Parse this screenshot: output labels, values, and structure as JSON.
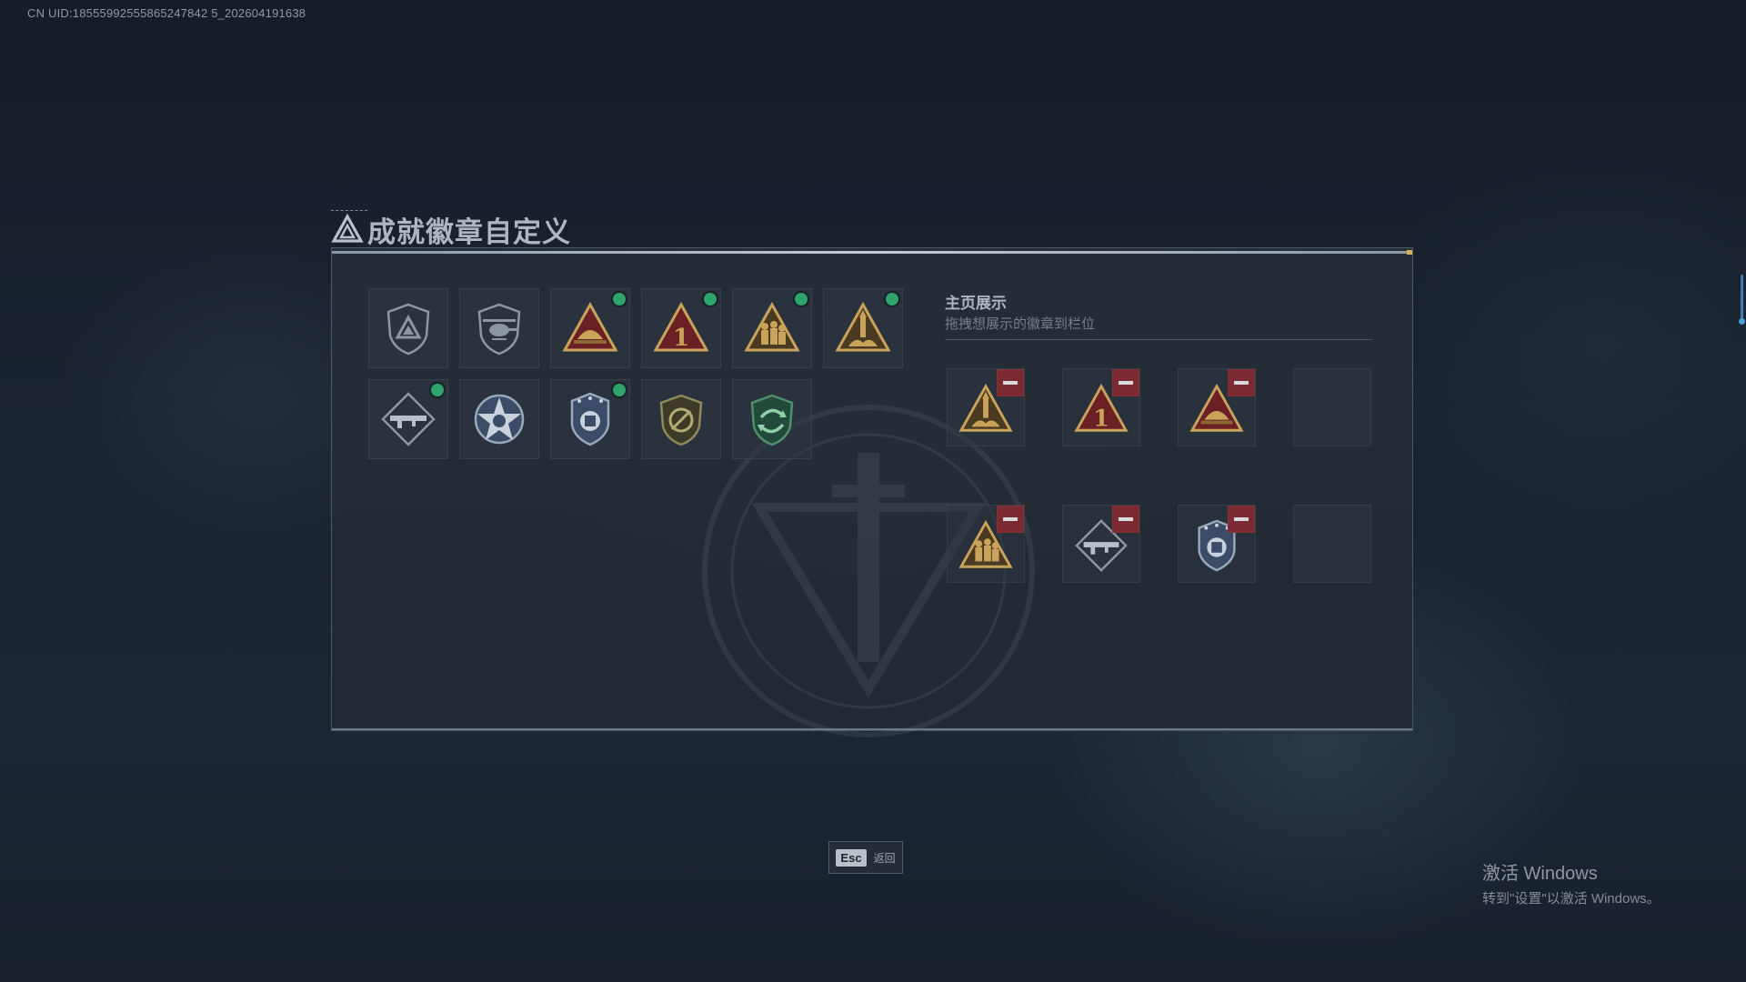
{
  "uid_text": "CN UID:18555992555865247842 5_202604191638",
  "window": {
    "title": "成就徽章自定义",
    "title_icon": "triangle-logo-icon"
  },
  "badges": [
    {
      "icon": "shield-triangle-icon",
      "has_dot": false
    },
    {
      "icon": "shield-helicopter-icon",
      "has_dot": false
    },
    {
      "icon": "helmet-triangle-icon",
      "has_dot": true
    },
    {
      "icon": "number-one-triangle-icon",
      "has_dot": true
    },
    {
      "icon": "soldiers-triangle-icon",
      "has_dot": true
    },
    {
      "icon": "rocket-triangle-icon",
      "has_dot": true
    },
    {
      "icon": "rifle-diamond-icon",
      "has_dot": true
    },
    {
      "icon": "star-emblem-icon",
      "has_dot": false
    },
    {
      "icon": "police-badge-icon",
      "has_dot": true
    },
    {
      "icon": "no-weapon-shield-icon",
      "has_dot": false
    },
    {
      "icon": "green-arrows-shield-icon",
      "has_dot": false
    }
  ],
  "display": {
    "title": "主页展示",
    "subtitle": "拖拽想展示的徽章到栏位",
    "slots": [
      {
        "icon": "rocket-triangle-icon",
        "filled": true
      },
      {
        "icon": "number-one-triangle-icon",
        "filled": true
      },
      {
        "icon": "helmet-triangle-icon",
        "filled": true
      },
      {
        "icon": "",
        "filled": false
      },
      {
        "icon": "soldiers-triangle-icon",
        "filled": true
      },
      {
        "icon": "rifle-diamond-icon",
        "filled": true
      },
      {
        "icon": "police-badge-icon",
        "filled": true
      },
      {
        "icon": "",
        "filled": false
      }
    ]
  },
  "esc": {
    "key": "Esc",
    "label": "返回"
  },
  "activation": {
    "title": "激活 Windows",
    "subtitle": "转到\"设置\"以激活 Windows。"
  },
  "colors": {
    "dot": "#2fa46a",
    "remove": "#7a2a30",
    "gold": "#c9a35a",
    "panel_border": "#4d5866"
  }
}
